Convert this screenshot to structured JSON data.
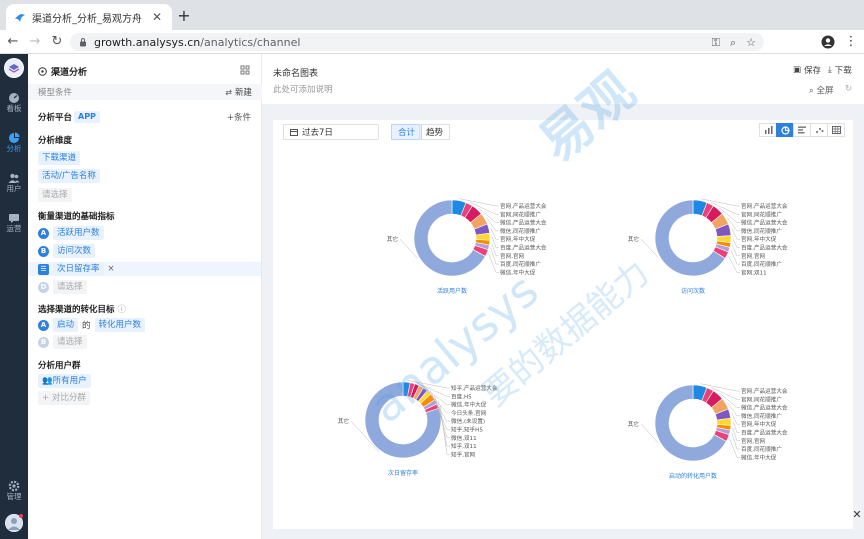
{
  "browser": {
    "tab_title": "渠道分析_分析_易观方舟",
    "url_host": "growth.analysys.cn",
    "url_path": "/analytics/channel"
  },
  "nav": {
    "items": [
      {
        "label": "看板",
        "icon": "dashboard-icon"
      },
      {
        "label": "分析",
        "icon": "pie-chart-icon",
        "active": true
      },
      {
        "label": "用户",
        "icon": "users-icon"
      },
      {
        "label": "运营",
        "icon": "message-icon"
      },
      {
        "label": "管理",
        "icon": "gear-icon"
      }
    ]
  },
  "config": {
    "title": "渠道分析",
    "model_label": "模型条件",
    "new_label": "新建",
    "platform_label": "分析平台",
    "platform_value": "APP",
    "add_condition": "+条件",
    "dimension_title": "分析维度",
    "dimensions": [
      "下载渠道",
      "活动/广告名称"
    ],
    "dimension_placeholder": "请选择",
    "metric_title": "衡量渠道的基础指标",
    "metrics": [
      {
        "badge": "A",
        "label": "活跃用户数"
      },
      {
        "badge": "B",
        "label": "访问次数"
      },
      {
        "badge": "C",
        "label": "次日留存率"
      }
    ],
    "metric_placeholder_badge": "D",
    "metric_placeholder": "请选择",
    "conversion_title": "选择渠道的转化目标",
    "conversion": {
      "badge": "A",
      "event": "启动",
      "of": "的",
      "measure": "转化用户数"
    },
    "conversion_placeholder_badge": "B",
    "conversion_placeholder": "请选择",
    "group_title": "分析用户群",
    "group_value": "所有用户",
    "group_compare": "+ 对比分群"
  },
  "main": {
    "chart_name": "未命名图表",
    "chart_desc": "此处可添加说明",
    "save": "保存",
    "download": "下载",
    "fullscreen": "全屏",
    "date_range": "过去7日",
    "seg_total": "合计",
    "seg_trend": "趋势"
  },
  "watermark": {
    "brand_en": "analysys",
    "brand_cn": "易观",
    "slogan": "要的数据能力"
  },
  "colors": {
    "blue": "#1e88e5",
    "pink": "#ec407a",
    "magenta": "#d81b60",
    "peach": "#f4a261",
    "purple": "#7e57c2",
    "yellow": "#fdd835",
    "orange": "#fb8c00",
    "lavender": "#b39ddb",
    "other": "#8fa9dc"
  },
  "chart_data": [
    {
      "type": "pie",
      "title": "活跃用户数",
      "slices": [
        {
          "name": "官网,产品运营大会",
          "value": 6
        },
        {
          "name": "官网,同花顺推广",
          "value": 3
        },
        {
          "name": "微信,产品运营大会",
          "value": 5
        },
        {
          "name": "微信,同花顺推广",
          "value": 5
        },
        {
          "name": "官网,年中大促",
          "value": 4
        },
        {
          "name": "百度,产品运营大会",
          "value": 3
        },
        {
          "name": "官网,官网",
          "value": 2
        },
        {
          "name": "百度,同花顺推广",
          "value": 2
        },
        {
          "name": "微信,年中大促",
          "value": 3
        },
        {
          "name": "其它",
          "value": 67
        }
      ]
    },
    {
      "type": "pie",
      "title": "访问次数",
      "slices": [
        {
          "name": "官网,产品运营大会",
          "value": 6
        },
        {
          "name": "官网,同花顺推广",
          "value": 3
        },
        {
          "name": "微信,产品运营大会",
          "value": 5
        },
        {
          "name": "微信,同花顺推广",
          "value": 5
        },
        {
          "name": "官网,年中大促",
          "value": 5
        },
        {
          "name": "百度,产品运营大会",
          "value": 3
        },
        {
          "name": "官网,官网",
          "value": 2
        },
        {
          "name": "百度,同花顺推广",
          "value": 2
        },
        {
          "name": "官网,双11",
          "value": 3
        },
        {
          "name": "其它",
          "value": 66
        }
      ]
    },
    {
      "type": "pie",
      "title": "次日留存率",
      "slices": [
        {
          "name": "知乎,产品运营大会",
          "value": 3
        },
        {
          "name": "百度,H5",
          "value": 2
        },
        {
          "name": "微信,年中大促",
          "value": 2
        },
        {
          "name": "今日头条,官网",
          "value": 2
        },
        {
          "name": "微信,(未设置)",
          "value": 2
        },
        {
          "name": "知乎,知乎H5",
          "value": 2
        },
        {
          "name": "微信,双11",
          "value": 3
        },
        {
          "name": "知乎,双11",
          "value": 2
        },
        {
          "name": "知乎,官网",
          "value": 2
        },
        {
          "name": "其它",
          "value": 80
        }
      ]
    },
    {
      "type": "pie",
      "title": "启动的转化用户数",
      "slices": [
        {
          "name": "官网,产品运营大会",
          "value": 6
        },
        {
          "name": "官网,同花顺推广",
          "value": 3
        },
        {
          "name": "微信,产品运营大会",
          "value": 5
        },
        {
          "name": "微信,同花顺推广",
          "value": 5
        },
        {
          "name": "官网,年中大促",
          "value": 4
        },
        {
          "name": "百度,产品运营大会",
          "value": 3
        },
        {
          "name": "官网,官网",
          "value": 2
        },
        {
          "name": "百度,同花顺推广",
          "value": 2
        },
        {
          "name": "微信,年中大促",
          "value": 3
        },
        {
          "name": "其它",
          "value": 67
        }
      ]
    }
  ]
}
